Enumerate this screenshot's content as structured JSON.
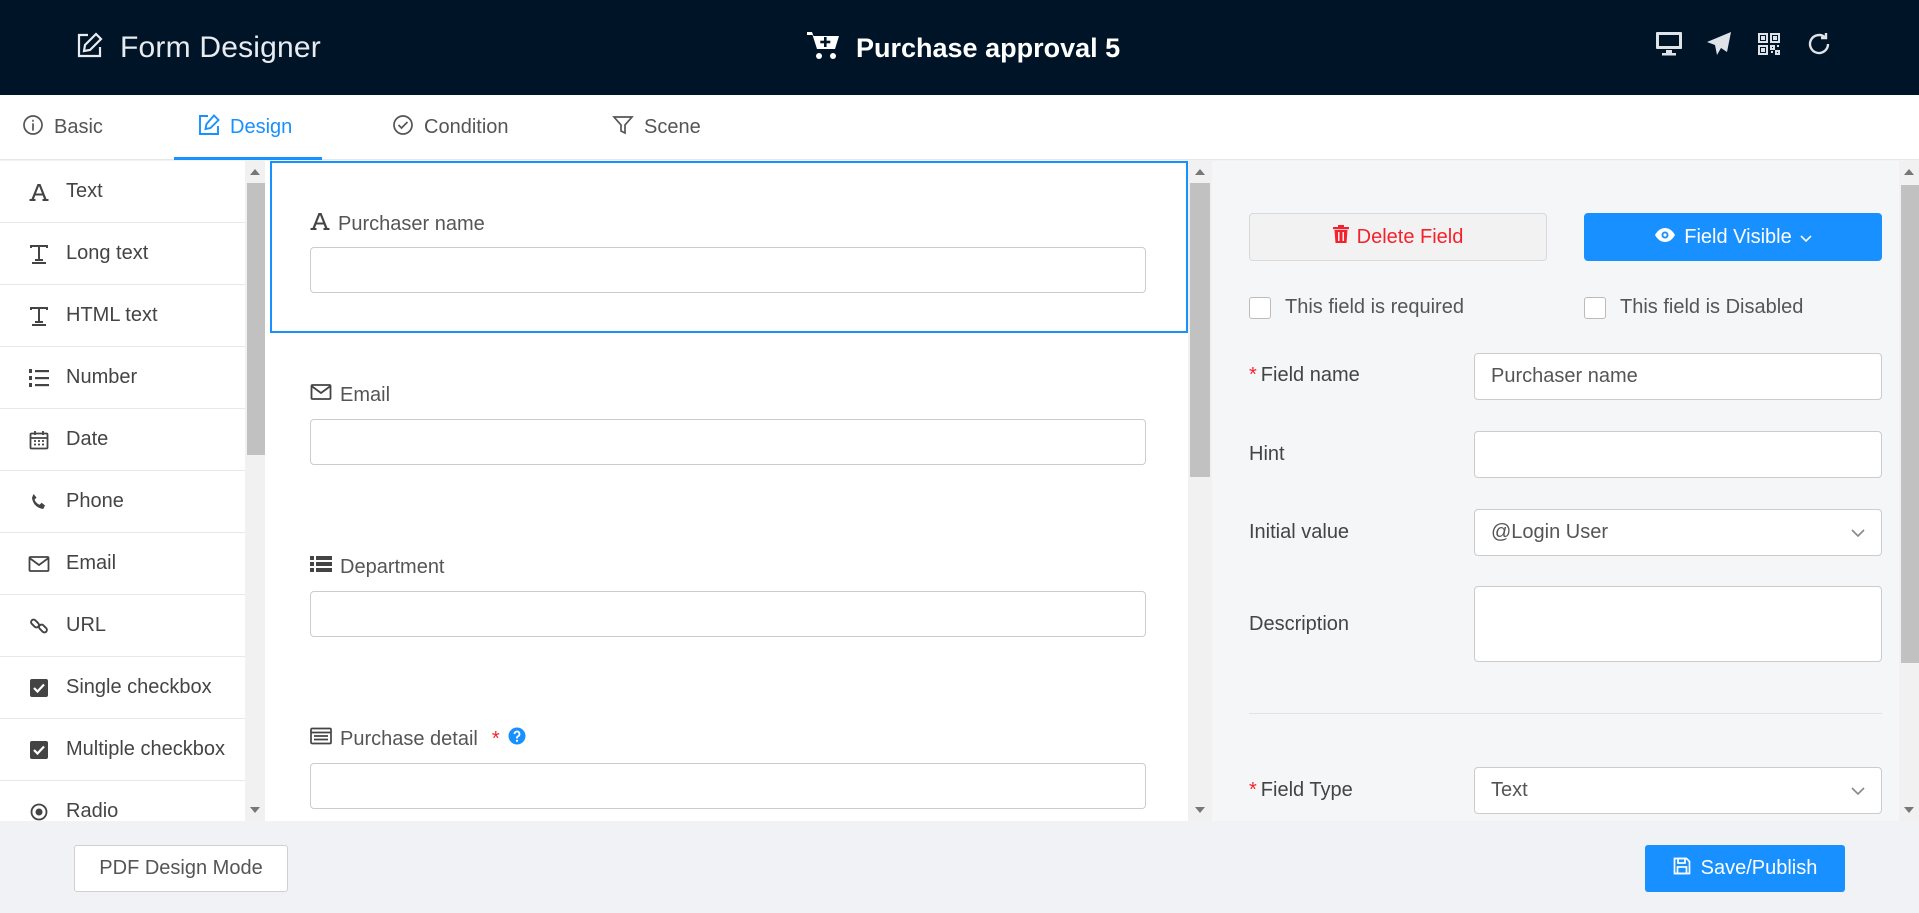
{
  "header": {
    "brand_icon": "edit-square-icon",
    "brand_label": "Form Designer",
    "title_icon": "cart-plus-icon",
    "title": "Purchase approval 5",
    "tools": [
      "desktop-icon",
      "send-icon",
      "qrcode-icon",
      "reload-icon"
    ]
  },
  "tabs": [
    {
      "label": "Basic",
      "icon": "info-circle-icon",
      "active": false
    },
    {
      "label": "Design",
      "icon": "edit-icon",
      "active": true
    },
    {
      "label": "Condition",
      "icon": "check-circle-icon",
      "active": false
    },
    {
      "label": "Scene",
      "icon": "filter-icon",
      "active": false
    }
  ],
  "palette": {
    "items": [
      {
        "label": "Text",
        "icon": "font-icon"
      },
      {
        "label": "Long text",
        "icon": "text-icon"
      },
      {
        "label": "HTML text",
        "icon": "text-icon"
      },
      {
        "label": "Number",
        "icon": "ordered-list-icon"
      },
      {
        "label": "Date",
        "icon": "calendar-icon"
      },
      {
        "label": "Phone",
        "icon": "phone-icon"
      },
      {
        "label": "Email",
        "icon": "mail-icon"
      },
      {
        "label": "URL",
        "icon": "link-icon"
      },
      {
        "label": "Single checkbox",
        "icon": "checkbox-icon"
      },
      {
        "label": "Multiple checkbox",
        "icon": "checkbox-icon"
      },
      {
        "label": "Radio",
        "icon": "radio-icon"
      }
    ]
  },
  "canvas": {
    "fields": [
      {
        "label": "Purchaser name",
        "icon": "font-icon",
        "selected": true,
        "required": false,
        "value": ""
      },
      {
        "label": "Email",
        "icon": "mail-icon",
        "selected": false,
        "required": false,
        "value": ""
      },
      {
        "label": "Department",
        "icon": "list-icon",
        "selected": false,
        "required": false,
        "value": ""
      },
      {
        "label": "Purchase detail",
        "icon": "table-icon",
        "selected": false,
        "required": true,
        "required_mark": "*",
        "help_icon": "question-circle-icon",
        "value": ""
      }
    ]
  },
  "properties": {
    "delete_label": "Delete Field",
    "delete_icon": "trash-icon",
    "visible_label": "Field Visible",
    "visible_icon": "eye-icon",
    "required_label": "This field is required",
    "disabled_label": "This field is Disabled",
    "field_name": {
      "label": "Field name",
      "required_mark": "*",
      "value": "Purchaser name"
    },
    "hint": {
      "label": "Hint",
      "value": ""
    },
    "initial_value": {
      "label": "Initial value",
      "value": "@Login User"
    },
    "description": {
      "label": "Description",
      "value": ""
    },
    "field_type": {
      "label": "Field Type",
      "required_mark": "*",
      "value": "Text"
    }
  },
  "footer": {
    "pdf_label": "PDF Design Mode",
    "save_label": "Save/Publish",
    "save_icon": "save-icon"
  },
  "colors": {
    "header_bg": "#001428",
    "accent": "#1890ff",
    "danger": "#f5222d"
  }
}
